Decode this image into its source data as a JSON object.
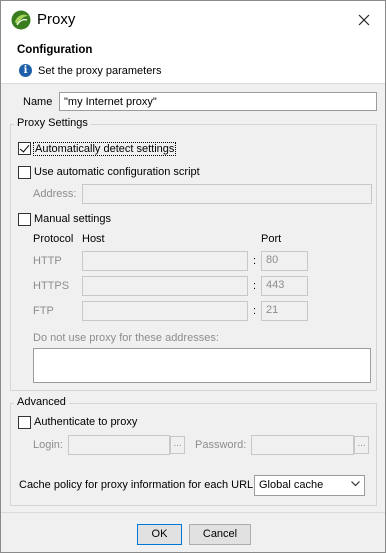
{
  "window": {
    "title": "Proxy",
    "close_glyph": "✕"
  },
  "header": {
    "title": "Configuration",
    "subtitle": "Set the proxy parameters",
    "info_glyph": "i"
  },
  "name": {
    "label": "Name",
    "value": "\"my Internet proxy\""
  },
  "proxy_settings": {
    "title": "Proxy Settings",
    "auto_detect": {
      "label": "Automatically detect settings",
      "checked": true
    },
    "auto_script": {
      "label": "Use automatic configuration script",
      "checked": false
    },
    "address": {
      "label": "Address:",
      "value": ""
    },
    "manual": {
      "label": "Manual settings",
      "checked": false
    },
    "columns": {
      "protocol": "Protocol",
      "host": "Host",
      "port": "Port"
    },
    "rows": [
      {
        "protocol": "HTTP",
        "host": "",
        "sep": ":",
        "port": "80"
      },
      {
        "protocol": "HTTPS",
        "host": "",
        "sep": ":",
        "port": "443"
      },
      {
        "protocol": "FTP",
        "host": "",
        "sep": ":",
        "port": "21"
      }
    ],
    "bypass": {
      "label": "Do not use proxy for these addresses:",
      "value": ""
    }
  },
  "advanced": {
    "title": "Advanced",
    "authenticate": {
      "label": "Authenticate to proxy",
      "checked": false
    },
    "login": {
      "label": "Login:",
      "value": "",
      "button": "..."
    },
    "password": {
      "label": "Password:",
      "value": "",
      "button": "..."
    },
    "cache": {
      "label": "Cache policy for proxy information for each URL",
      "selected": "Global cache"
    }
  },
  "footer": {
    "ok": "OK",
    "cancel": "Cancel"
  },
  "colors": {
    "accent": "#0078d7",
    "info_icon": "#1f5fa8"
  }
}
